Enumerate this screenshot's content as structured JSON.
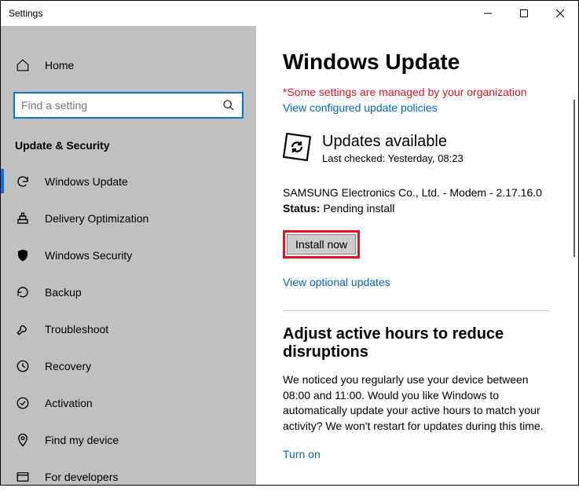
{
  "window": {
    "title": "Settings"
  },
  "sidebar": {
    "home": "Home",
    "search_placeholder": "Find a setting",
    "group": "Update & Security",
    "items": [
      {
        "label": "Windows Update"
      },
      {
        "label": "Delivery Optimization"
      },
      {
        "label": "Windows Security"
      },
      {
        "label": "Backup"
      },
      {
        "label": "Troubleshoot"
      },
      {
        "label": "Recovery"
      },
      {
        "label": "Activation"
      },
      {
        "label": "Find my device"
      },
      {
        "label": "For developers"
      }
    ]
  },
  "main": {
    "title": "Windows Update",
    "managed_notice": "*Some settings are managed by your organization",
    "view_policies": "View configured update policies",
    "updates_available": "Updates available",
    "last_checked": "Last checked: Yesterday, 08:23",
    "driver_line": "SAMSUNG Electronics Co., Ltd.  - Modem - 2.17.16.0",
    "status_label": "Status:",
    "status_value": " Pending install",
    "install_now": "Install now",
    "view_optional": "View optional updates",
    "adjust_title": "Adjust active hours to reduce disruptions",
    "adjust_body": "We noticed you regularly use your device between 08:00 and 11:00. Would you like Windows to automatically update your active hours to match your activity? We won't restart for updates during this time.",
    "turn_on": "Turn on"
  }
}
